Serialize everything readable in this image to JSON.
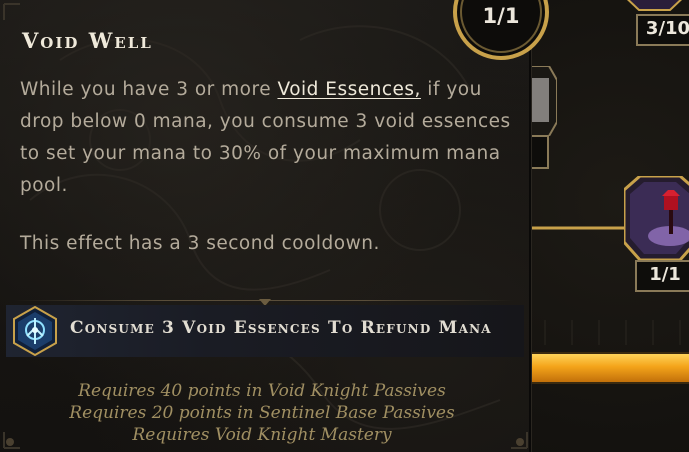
{
  "tooltip": {
    "title": "Void Well",
    "desc_part1": "While you have 3 or more ",
    "desc_keyword": "Void Essences,",
    "desc_part2": " if you drop below 0 mana, you consume 3 void essences to set your mana to 30% of your maximum mana pool.",
    "cooldown": "This effect has a 3 second cooldown.",
    "ability": {
      "label": "Consume 3 Void Essences To Refund Mana",
      "icon": "void-sigil-icon"
    },
    "requirements": [
      "Requires 40 points in Void Knight Passives",
      "Requires 20 points in Sentinel Base Passives",
      "Requires Void Knight Mastery"
    ],
    "points": "1/1"
  },
  "tree": {
    "nodes": [
      {
        "label": "3/10",
        "icon": "purple-node-icon"
      },
      {
        "label": "1/1",
        "icon": "blood-chalice-icon"
      }
    ]
  },
  "colors": {
    "title": "#efe9da",
    "body": "#b4ab9b",
    "requirement": "#a08f62",
    "accent_gold": "#c8a14a",
    "xp_bar": "#f4a41a"
  }
}
